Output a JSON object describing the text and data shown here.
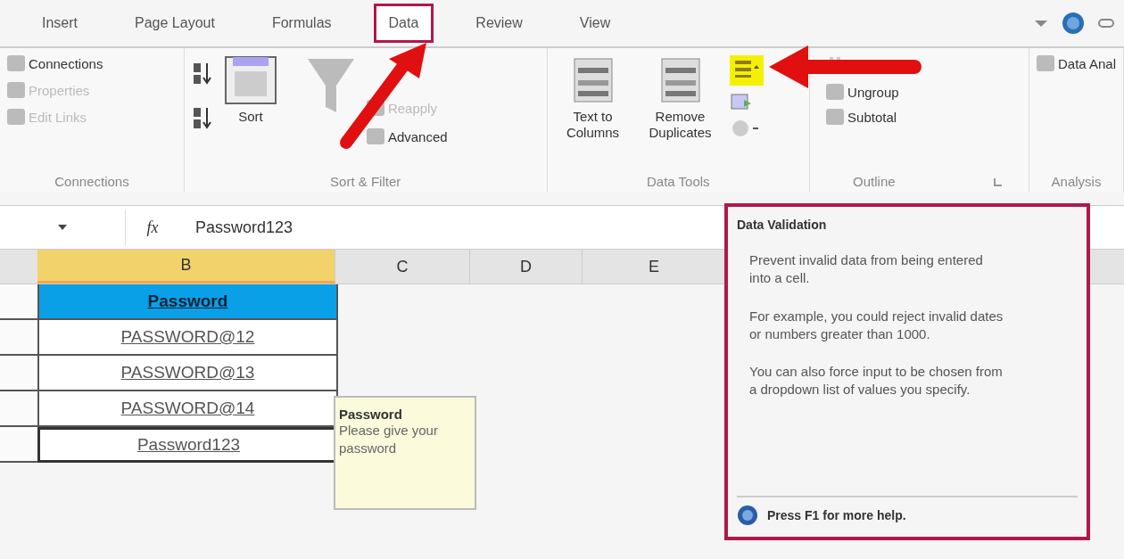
{
  "ribbon_tabs": [
    {
      "label": "Insert",
      "selected": false
    },
    {
      "label": "Page Layout",
      "selected": false
    },
    {
      "label": "Formulas",
      "selected": false
    },
    {
      "label": "Data",
      "selected": true
    },
    {
      "label": "Review",
      "selected": false
    },
    {
      "label": "View",
      "selected": false
    }
  ],
  "ribbon_groups": [
    {
      "label": "Connections",
      "items": [
        {
          "label": "Connections",
          "disabled": false
        },
        {
          "label": "Properties",
          "disabled": true
        },
        {
          "label": "Edit Links",
          "disabled": true
        }
      ]
    },
    {
      "label": "Sort & Filter",
      "items": [
        {
          "label": "Sort",
          "disabled": false
        },
        {
          "label": "Reapply",
          "disabled": true
        },
        {
          "label": "Advanced",
          "disabled": false
        }
      ]
    },
    {
      "label": "Data Tools",
      "items": [
        {
          "label": "Text to Columns",
          "disabled": false
        },
        {
          "label": "Remove Duplicates",
          "disabled": false
        }
      ],
      "validation_highlighted": true
    },
    {
      "label": "Outline",
      "items": [
        {
          "label": "Ungroup",
          "disabled": false
        },
        {
          "label": "Subtotal",
          "disabled": false
        }
      ]
    },
    {
      "label": "Analysis",
      "items": [
        {
          "label": "Data Anal",
          "disabled": false
        }
      ]
    }
  ],
  "formula_bar": {
    "fx": "fx",
    "value": "Password123"
  },
  "columns": [
    {
      "label": "B",
      "selected": true
    },
    {
      "label": "C",
      "selected": false
    },
    {
      "label": "D",
      "selected": false
    },
    {
      "label": "E",
      "selected": false
    }
  ],
  "cells": [
    {
      "text": "Password",
      "kind": "header",
      "selected": false
    },
    {
      "text": "PASSWORD@12",
      "kind": "value",
      "selected": false
    },
    {
      "text": "PASSWORD@13",
      "kind": "value",
      "selected": false
    },
    {
      "text": "PASSWORD@14",
      "kind": "value",
      "selected": false
    },
    {
      "text": "Password123",
      "kind": "value",
      "selected": true
    }
  ],
  "input_message": {
    "title": "Password",
    "text": "Please give your password"
  },
  "tooltip": {
    "title": "Data Validation",
    "paragraphs": [
      "Prevent invalid data from being entered into a cell.",
      "For example, you could reject invalid dates or numbers greater than 1000.",
      "You can also force input to be chosen from a dropdown list of values you specify."
    ],
    "help": "Press F1 for more help."
  }
}
